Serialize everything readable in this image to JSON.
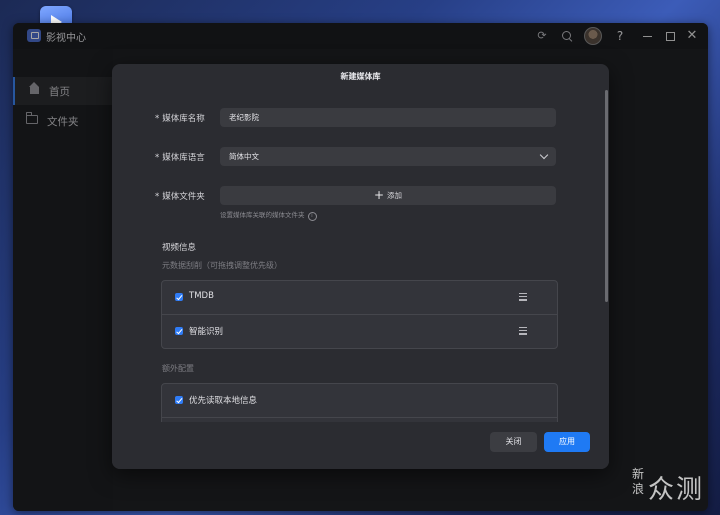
{
  "app": {
    "title": "影视中心",
    "header_icons": [
      "sync-icon",
      "search-icon",
      "avatar",
      "help-icon",
      "minimize-icon",
      "maximize-icon",
      "close-icon"
    ],
    "help_glyph": "?",
    "close_glyph": "✕"
  },
  "sidebar": {
    "items": [
      {
        "label": "首页",
        "icon": "home-icon",
        "active": true
      },
      {
        "label": "文件夹",
        "icon": "folder-icon",
        "active": false
      }
    ]
  },
  "dialog": {
    "title": "新建媒体库",
    "name": {
      "label": "媒体库名称",
      "required": true,
      "value": "老纪影院"
    },
    "language": {
      "label": "媒体库语言",
      "required": true,
      "value": "简体中文"
    },
    "folder": {
      "label": "媒体文件夹",
      "required": true,
      "add_label": "添加",
      "hint": "设置媒体库关联的媒体文件夹"
    },
    "video_info": {
      "title": "视频信息",
      "subtitle": "元数据刮削（可拖拽调整优先级）",
      "scrapers": [
        {
          "label": "TMDB",
          "checked": true
        },
        {
          "label": "智能识别",
          "checked": true
        }
      ]
    },
    "extra": {
      "title": "额外配置",
      "options": [
        {
          "label": "优先读取本地信息",
          "checked": true
        }
      ]
    },
    "buttons": {
      "close": "关闭",
      "apply": "应用"
    }
  },
  "watermark": {
    "small": "新浪",
    "big": "众测"
  },
  "colors": {
    "accent": "#1f7af4",
    "dialog_bg": "#2b2c31",
    "window_bg": "#202124"
  }
}
